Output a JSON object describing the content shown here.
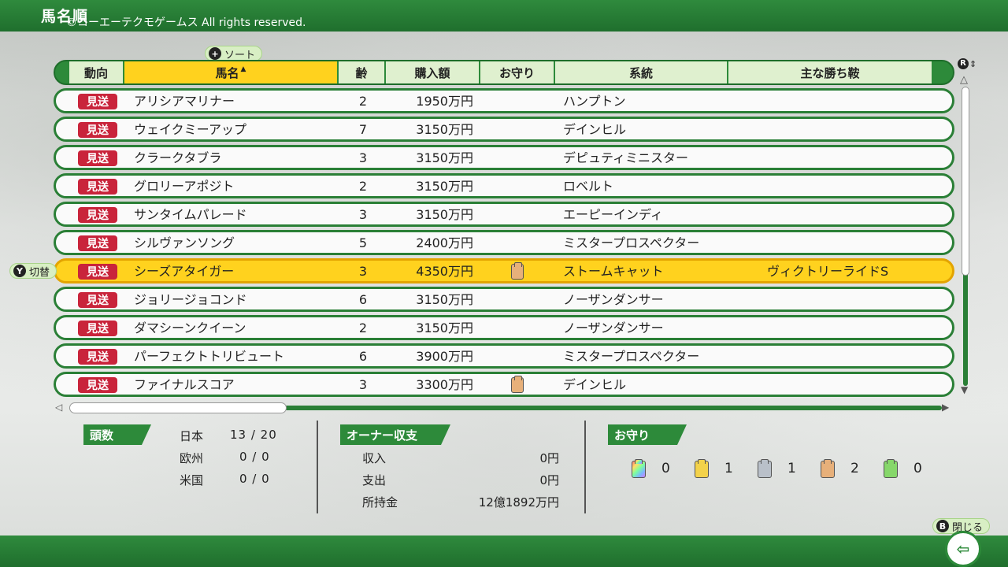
{
  "topbar": {
    "title": "馬名順",
    "copyright": "©コーエーテクモゲームス All rights reserved."
  },
  "hints": {
    "sort": {
      "button": "+",
      "label": "ソート"
    },
    "switch": {
      "button": "Y",
      "label": "切替"
    },
    "scroll": {
      "button": "R",
      "label": "⇕"
    },
    "close": {
      "button": "B",
      "label": "閉じる"
    }
  },
  "table": {
    "headers": {
      "direction": "動向",
      "name": "馬名",
      "sort_indicator": "▲",
      "age": "齢",
      "price": "購入額",
      "charm": "お守り",
      "lineage": "系統",
      "wins": "主な勝ち鞍"
    },
    "rows": [
      {
        "tag": "見送",
        "name": "アリシアマリナー",
        "age": "2",
        "price": "1950万円",
        "charm": "",
        "lineage": "ハンプトン",
        "wins": ""
      },
      {
        "tag": "見送",
        "name": "ウェイクミーアップ",
        "age": "7",
        "price": "3150万円",
        "charm": "",
        "lineage": "デインヒル",
        "wins": ""
      },
      {
        "tag": "見送",
        "name": "クラークタブラ",
        "age": "3",
        "price": "3150万円",
        "charm": "",
        "lineage": "デピュティミニスター",
        "wins": ""
      },
      {
        "tag": "見送",
        "name": "グロリーアポジト",
        "age": "2",
        "price": "3150万円",
        "charm": "",
        "lineage": "ロベルト",
        "wins": ""
      },
      {
        "tag": "見送",
        "name": "サンタイムパレード",
        "age": "3",
        "price": "3150万円",
        "charm": "",
        "lineage": "エーピーインディ",
        "wins": ""
      },
      {
        "tag": "見送",
        "name": "シルヴァンソング",
        "age": "5",
        "price": "2400万円",
        "charm": "",
        "lineage": "ミスタープロスペクター",
        "wins": ""
      },
      {
        "tag": "見送",
        "name": "シーズアタイガー",
        "age": "3",
        "price": "4350万円",
        "charm": "bronze",
        "lineage": "ストームキャット",
        "wins": "ヴィクトリーライドS"
      },
      {
        "tag": "見送",
        "name": "ジョリージョコンド",
        "age": "6",
        "price": "3150万円",
        "charm": "",
        "lineage": "ノーザンダンサー",
        "wins": ""
      },
      {
        "tag": "見送",
        "name": "ダマシーンクイーン",
        "age": "2",
        "price": "3150万円",
        "charm": "",
        "lineage": "ノーザンダンサー",
        "wins": ""
      },
      {
        "tag": "見送",
        "name": "パーフェクトトリビュート",
        "age": "6",
        "price": "3900万円",
        "charm": "",
        "lineage": "ミスタープロスペクター",
        "wins": ""
      },
      {
        "tag": "見送",
        "name": "ファイナルスコア",
        "age": "3",
        "price": "3300万円",
        "charm": "bronze",
        "lineage": "デインヒル",
        "wins": ""
      }
    ],
    "selected_index": 6
  },
  "head_count": {
    "title": "頭数",
    "japan": {
      "label": "日本",
      "value": "13 / 20"
    },
    "europe": {
      "label": "欧州",
      "value": "0 / 0"
    },
    "usa": {
      "label": "米国",
      "value": "0 / 0"
    }
  },
  "owner_balance": {
    "title": "オーナー収支",
    "income": {
      "label": "収入",
      "value": "0円"
    },
    "expense": {
      "label": "支出",
      "value": "0円"
    },
    "funds": {
      "label": "所持金",
      "value": "12億1892万円"
    }
  },
  "charms": {
    "title": "お守り",
    "items": [
      {
        "kind": "rainbow",
        "count": "0"
      },
      {
        "kind": "gold",
        "count": "1"
      },
      {
        "kind": "silver",
        "count": "1"
      },
      {
        "kind": "bronze",
        "count": "2"
      },
      {
        "kind": "green",
        "count": "0"
      }
    ]
  },
  "colors": {
    "accent_green": "#2d8a3a",
    "highlight_yellow": "#ffd21e",
    "tag_red": "#c9243b"
  }
}
